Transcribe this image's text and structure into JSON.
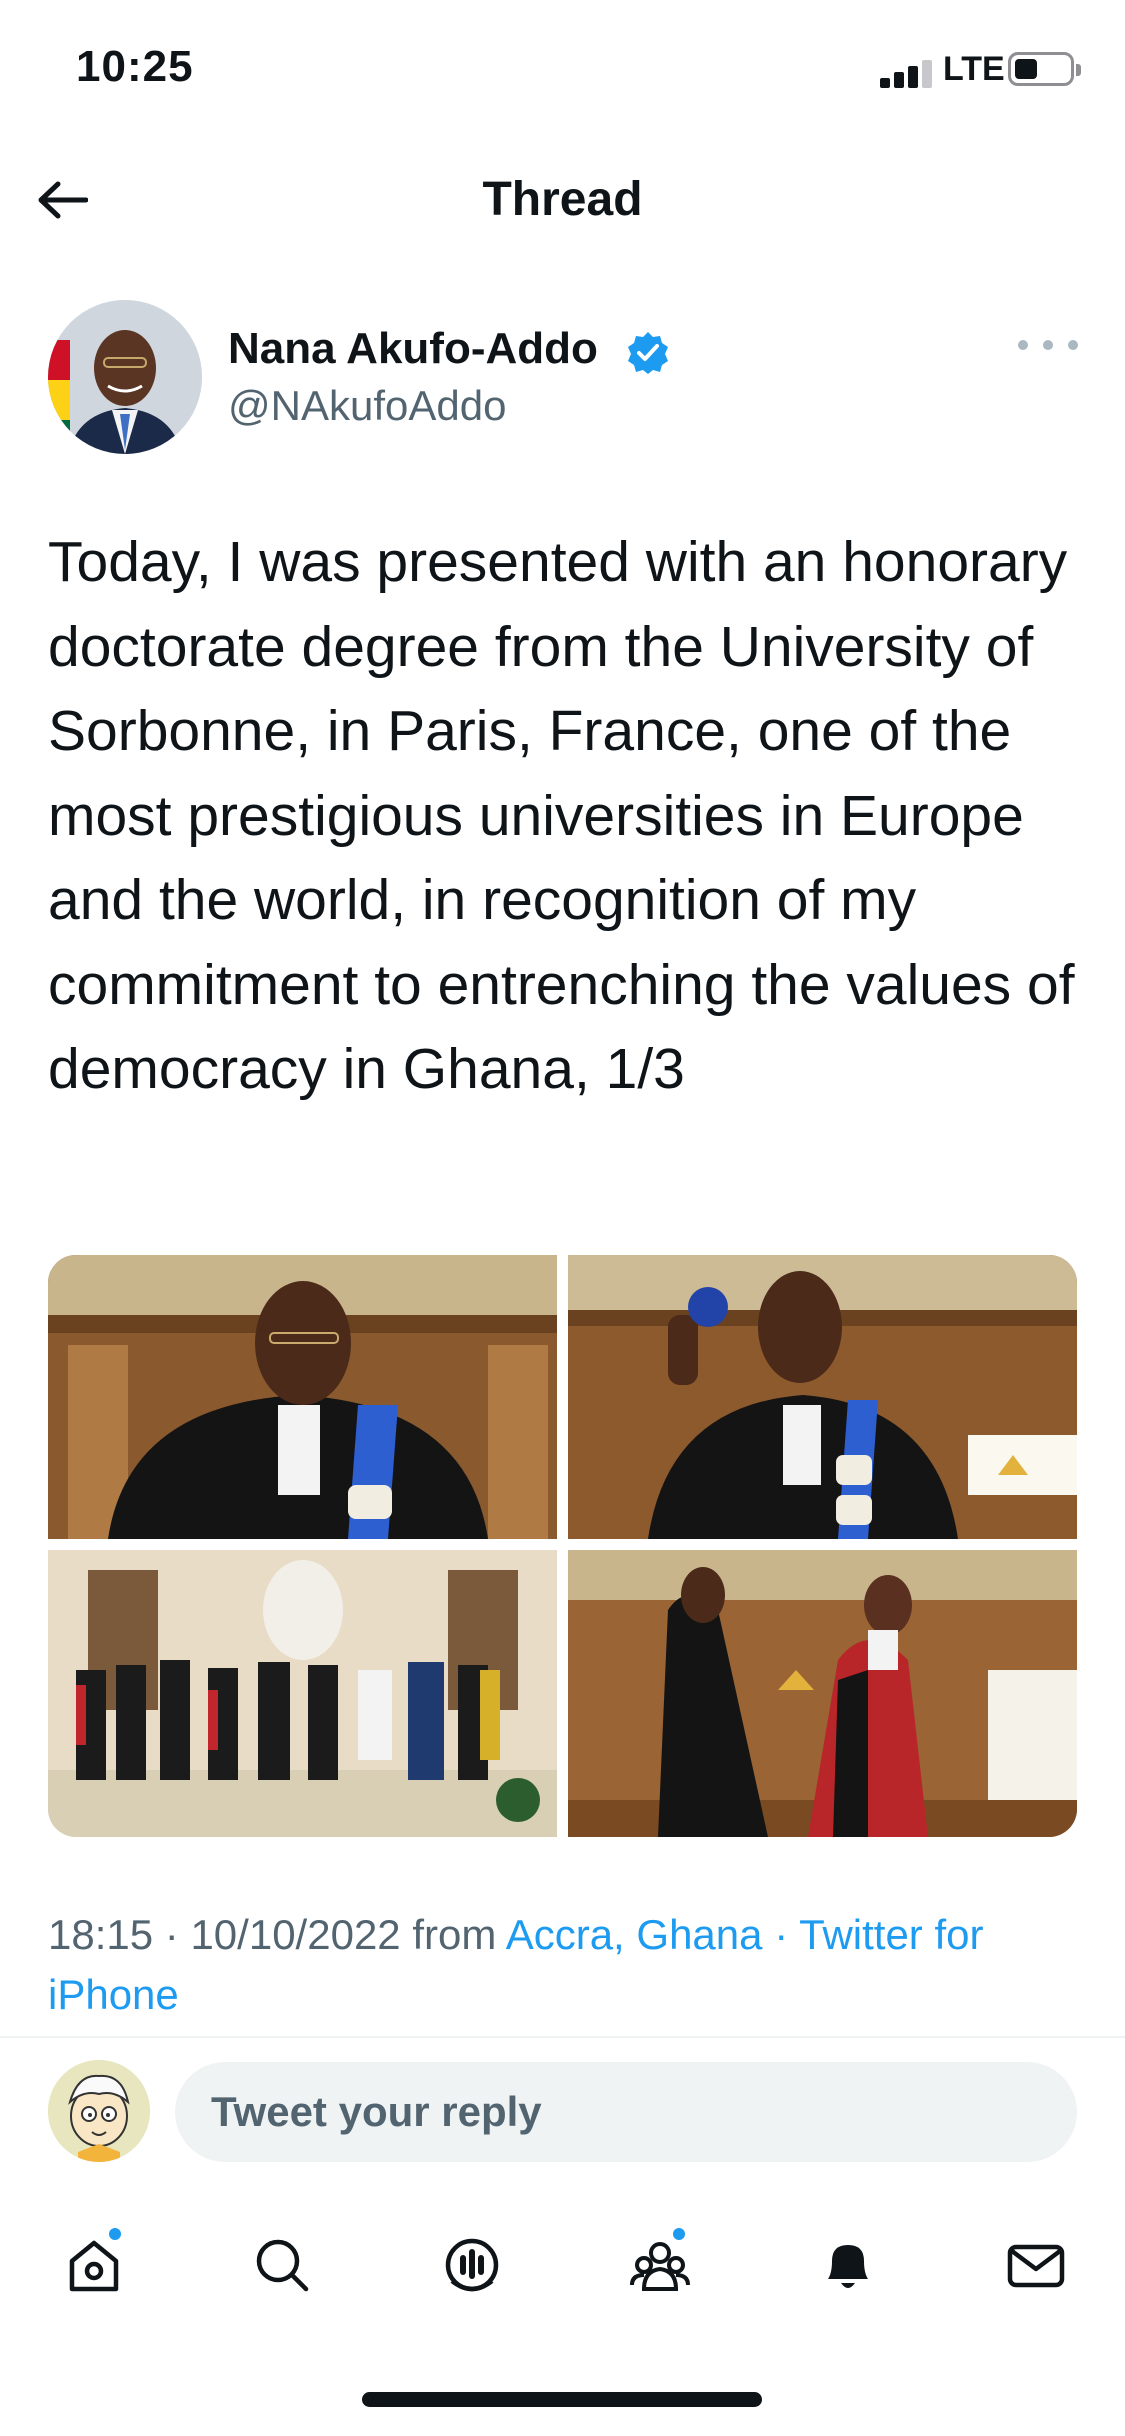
{
  "status_bar": {
    "time": "10:25",
    "network": "LTE"
  },
  "header": {
    "title": "Thread",
    "back_icon": "arrow-left-icon"
  },
  "tweet": {
    "author_name": "Nana Akufo-Addo",
    "author_handle": "@NAkufoAddo",
    "verified": true,
    "text": "Today, I was presented with an honorary doctorate degree from the University of Sorbonne, in Paris, France, one of the most prestigious universities in Europe and the world, in recognition of my commitment to entrenching the values of democracy in Ghana, 1/3",
    "photos": [
      "photo-1",
      "photo-2",
      "photo-3",
      "photo-4"
    ],
    "time": "18:15",
    "date": "10/10/2022",
    "from_label": "from",
    "location": "Accra, Ghana",
    "separator": "·",
    "source": "Twitter for iPhone"
  },
  "reply": {
    "placeholder": "Tweet your reply"
  },
  "tab_bar": {
    "items": [
      {
        "icon": "home-icon",
        "has_dot": true
      },
      {
        "icon": "search-icon",
        "has_dot": false
      },
      {
        "icon": "spaces-icon",
        "has_dot": false
      },
      {
        "icon": "communities-icon",
        "has_dot": true
      },
      {
        "icon": "notifications-icon",
        "has_dot": false
      },
      {
        "icon": "messages-icon",
        "has_dot": false
      }
    ]
  },
  "colors": {
    "accent": "#1d9bf0",
    "text_primary": "#0f1419",
    "text_secondary": "#536471"
  }
}
